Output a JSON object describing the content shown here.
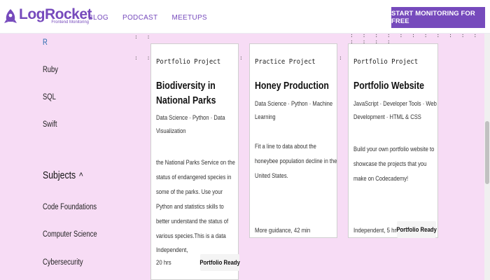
{
  "header": {
    "logo_word": "LogRocket",
    "logo_tag": "Frontend Monitoring",
    "nav": [
      "BLOG",
      "PODCAST",
      "MEETUPS"
    ],
    "cta": "START MONITORING FOR FREE"
  },
  "sidebar": {
    "languages": [
      "R",
      "Ruby",
      "SQL",
      "Swift"
    ],
    "subjects_heading": "Subjects",
    "subjects": [
      "Code Foundations",
      "Computer Science",
      "Cybersecurity"
    ]
  },
  "cards": [
    {
      "type": "Portfolio Project",
      "title": "Biodiversity in National Parks",
      "tags": "Data Science · Python · Data Visualization",
      "description": "the National Parks Service on the status of endangered species in some of the parks. Use your Python and statistics skills to better understand the status of various species.This is a data science subject with many projects",
      "meta": "Independent, 20 hrs",
      "badge": "Portfolio Ready"
    },
    {
      "type": "Practice Project",
      "title": "Honey Production",
      "tags": "Data Science · Python · Machine Learning",
      "description": "Fit a line to data about the honeybee population decline in the United States.",
      "meta": "More guidance, 42 min",
      "badge": ""
    },
    {
      "type": "Portfolio Project",
      "title": "Portfolio Website",
      "tags": "JavaScript · Developer Tools · Web Development · HTML & CSS",
      "description": "Build your own portfolio website to showcase the projects that you make on Codecademy!",
      "meta": "Independent, 5 hrs",
      "badge": "Portfolio Ready"
    }
  ],
  "colors": {
    "brand": "#764abc",
    "background": "#f7dcf5",
    "card": "#ffffff"
  }
}
